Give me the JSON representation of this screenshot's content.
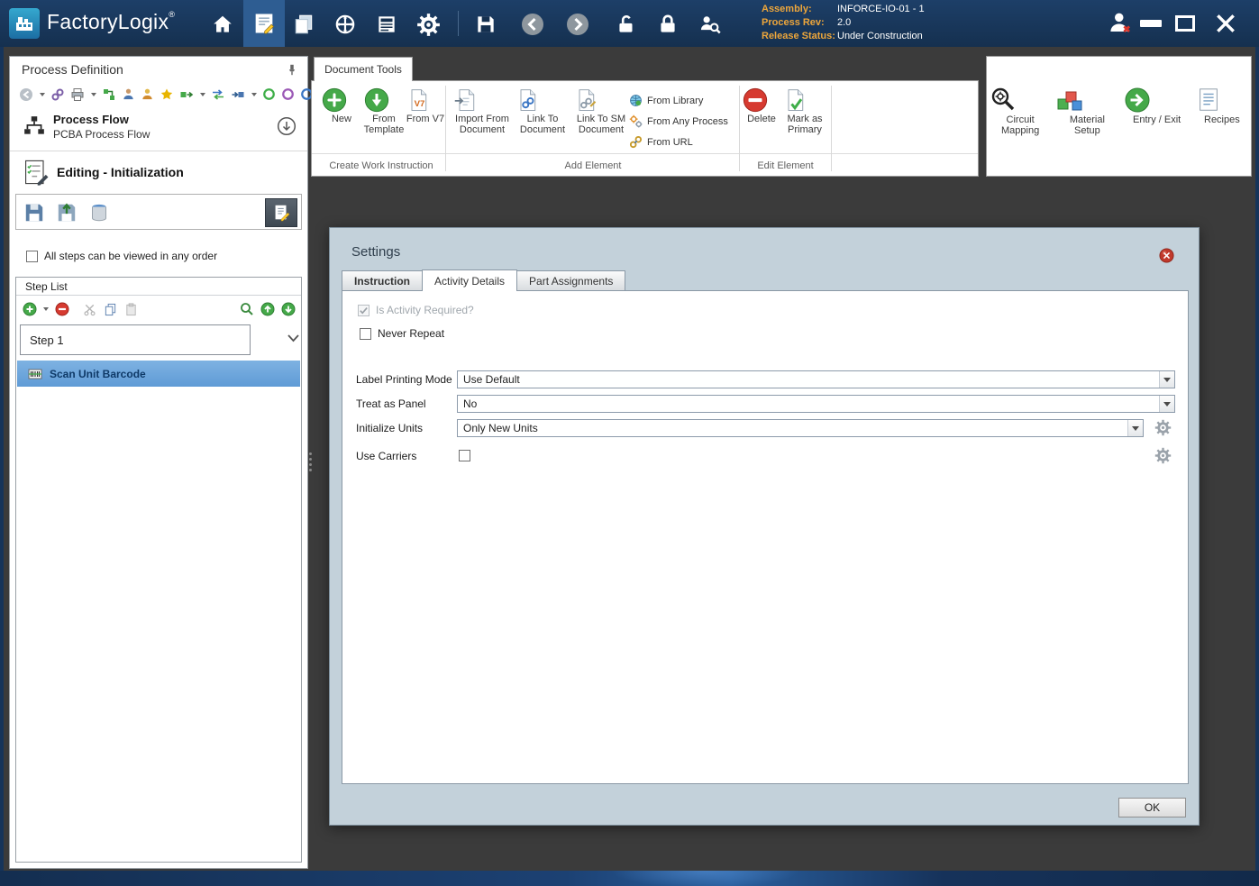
{
  "colors": {
    "titlebar": "#1d3f68",
    "content_bg": "#3b3b3b",
    "dialog_bg": "#c3d1da",
    "selection_blue": "#6fa3d8",
    "accent_green": "#45a949",
    "accent_red": "#d63a30",
    "info_label_orange": "#eda63b"
  },
  "icons": {
    "home-icon": "house",
    "gear-icon": "cog wheel",
    "save-icon": "floppy disk",
    "lock-icon": "closed padlock",
    "unlock-icon": "open padlock",
    "pin-icon": "pushpin",
    "new-icon": "green circle plus",
    "delete-icon": "red circle bar",
    "close-icon": "red circle x",
    "chevron-down-icon": "v chevron"
  },
  "titlebar": {
    "app_name": "FactoryLogix",
    "trademark": "®",
    "info": {
      "assembly_label": "Assembly:",
      "assembly_value": "INFORCE-IO-01 - 1",
      "process_rev_label": "Process Rev:",
      "process_rev_value": "2.0",
      "release_status_label": "Release Status:",
      "release_status_value": "Under Construction"
    }
  },
  "left_panel": {
    "title": "Process Definition",
    "process_flow": {
      "title": "Process Flow",
      "subtitle": "PCBA Process Flow"
    },
    "editing_header": "Editing - Initialization",
    "order_checkbox_label": "All steps can be viewed in any order",
    "step_list": {
      "title": "Step List",
      "selected_step": "Step 1",
      "steps": [
        {
          "label": "Scan Unit Barcode"
        }
      ]
    }
  },
  "ribbon": {
    "tab_label": "Document Tools",
    "groups": [
      {
        "label": "Create Work Instruction",
        "items": [
          {
            "label": "New"
          },
          {
            "label": "From Template"
          },
          {
            "label": "From V7"
          }
        ]
      },
      {
        "label": "Add Element",
        "items": [
          {
            "label": "Import From Document"
          },
          {
            "label": "Link To Document"
          },
          {
            "label": "Link To SM Document"
          },
          {
            "label": "From Library"
          },
          {
            "label": "From Any Process"
          },
          {
            "label": "From URL"
          }
        ]
      },
      {
        "label": "Edit Element",
        "items": [
          {
            "label": "Delete"
          },
          {
            "label": "Mark as Primary"
          }
        ]
      }
    ],
    "right_items": [
      {
        "label": "Circuit Mapping"
      },
      {
        "label": "Material Setup"
      },
      {
        "label": "Entry / Exit"
      },
      {
        "label": "Recipes"
      }
    ]
  },
  "settings_dialog": {
    "title": "Settings",
    "tabs": [
      {
        "label": "Instruction"
      },
      {
        "label": "Activity Details"
      },
      {
        "label": "Part Assignments"
      }
    ],
    "active_tab": "Activity Details",
    "checkboxes": {
      "is_activity_required": {
        "label": "Is Activity Required?",
        "checked": true,
        "enabled": false
      },
      "never_repeat": {
        "label": "Never Repeat",
        "checked": false,
        "enabled": true
      },
      "use_carriers": {
        "label": "Use Carriers",
        "checked": false,
        "enabled": true
      }
    },
    "fields": {
      "label_printing_mode": {
        "label": "Label Printing Mode",
        "value": "Use Default"
      },
      "treat_as_panel": {
        "label": "Treat as Panel",
        "value": "No"
      },
      "initialize_units": {
        "label": "Initialize Units",
        "value": "Only New Units"
      }
    },
    "ok_label": "OK"
  }
}
